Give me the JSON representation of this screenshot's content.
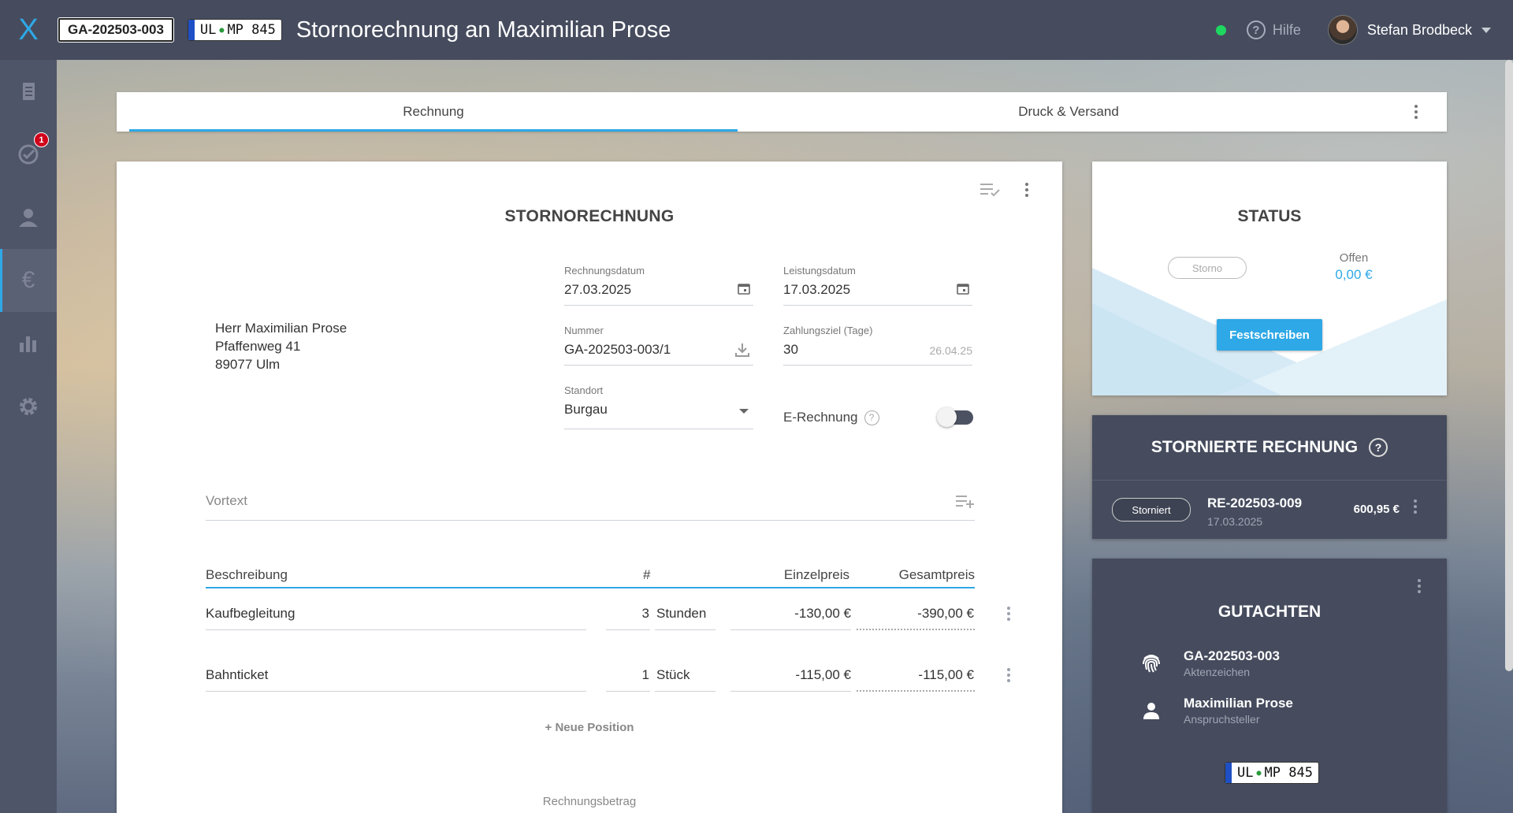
{
  "header": {
    "file_id": "GA-202503-003",
    "plate": {
      "region": "UL",
      "number": "MP 845"
    },
    "title": "Stornorechnung an Maximilian Prose",
    "help_label": "Hilfe",
    "user_name": "Stefan Brodbeck"
  },
  "sidebar": {
    "items": [
      {
        "name": "documents-icon"
      },
      {
        "name": "tasks-icon",
        "badge": "1"
      },
      {
        "name": "contacts-icon"
      },
      {
        "name": "euro-icon",
        "glyph": "€",
        "active": true
      },
      {
        "name": "statistics-icon"
      },
      {
        "name": "settings-icon"
      }
    ]
  },
  "tabs": [
    {
      "label": "Rechnung",
      "active": true
    },
    {
      "label": "Druck & Versand"
    }
  ],
  "invoice": {
    "title": "STORNORECHNUNG",
    "address": [
      "Herr Maximilian Prose",
      "Pfaffenweg 41",
      "89077 Ulm"
    ],
    "rechnungsdatum": {
      "label": "Rechnungsdatum",
      "value": "27.03.2025"
    },
    "leistungsdatum": {
      "label": "Leistungsdatum",
      "value": "17.03.2025"
    },
    "nummer": {
      "label": "Nummer",
      "value": "GA-202503-003/1"
    },
    "zahlungsziel": {
      "label": "Zahlungsziel (Tage)",
      "value": "30",
      "due": "26.04.25"
    },
    "standort": {
      "label": "Standort",
      "value": "Burgau"
    },
    "erechnung_label": "E-Rechnung",
    "vortext_placeholder": "Vortext",
    "columns": {
      "desc": "Beschreibung",
      "qty": "#",
      "unit_price": "Einzelpreis",
      "total": "Gesamtpreis"
    },
    "positions": [
      {
        "desc": "Kaufbegleitung",
        "qty": "3",
        "unit": "Stunden",
        "unit_price": "-130,00 €",
        "total": "-390,00 €"
      },
      {
        "desc": "Bahnticket",
        "qty": "1",
        "unit": "Stück",
        "unit_price": "-115,00 €",
        "total": "-115,00 €"
      }
    ],
    "new_position": "+ Neue Position",
    "rechnungsbetrag_label": "Rechnungsbetrag"
  },
  "status": {
    "title": "STATUS",
    "state_pill": "Storno",
    "open_label": "Offen",
    "open_value": "0,00 €",
    "button": "Festschreiben"
  },
  "storniert": {
    "title": "STORNIERTE RECHNUNG",
    "pill": "Storniert",
    "number": "RE-202503-009",
    "date": "17.03.2025",
    "amount": "600,95 €"
  },
  "gutachten": {
    "title": "GUTACHTEN",
    "file_id": "GA-202503-003",
    "file_label": "Aktenzeichen",
    "claimant": "Maximilian Prose",
    "claimant_label": "Anspruchsteller",
    "plate": {
      "region": "UL",
      "number": "MP 845"
    }
  },
  "colors": {
    "accent": "#2ea8e6",
    "topbar": "#464c5e",
    "sidebar": "#4f5568",
    "badge": "#d0021b",
    "online": "#1ed760"
  }
}
